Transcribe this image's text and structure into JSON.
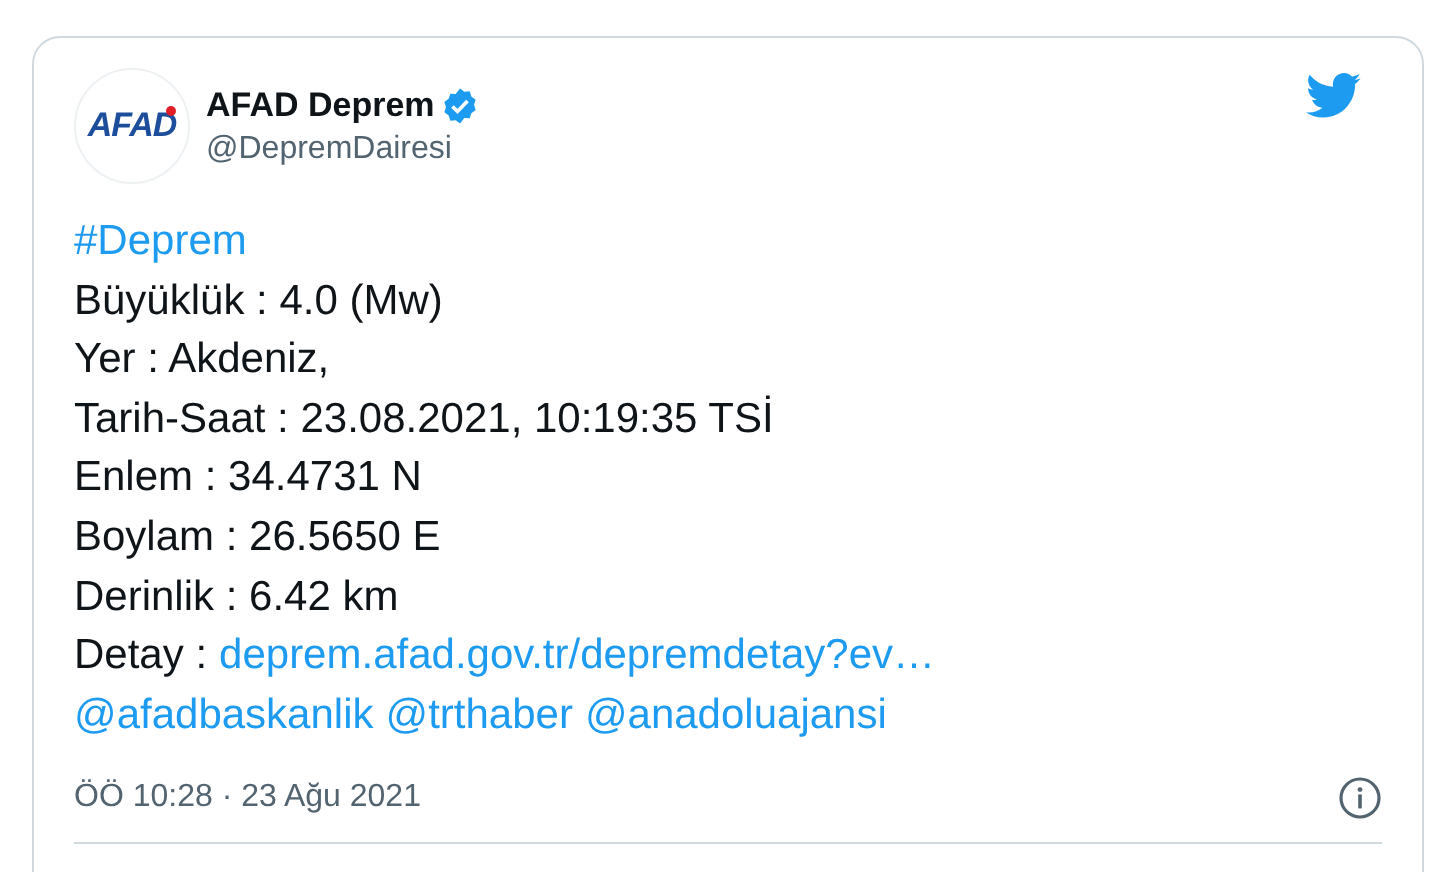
{
  "author": {
    "name": "AFAD Deprem",
    "verified": true,
    "handle": "@DepremDairesi",
    "avatar_text": "AFAD"
  },
  "lines": [
    [
      {
        "kind": "link",
        "text": "#Deprem"
      }
    ],
    [
      {
        "kind": "text",
        "text": "Büyüklük : 4.0 (Mw)"
      }
    ],
    [
      {
        "kind": "text",
        "text": "Yer : Akdeniz,"
      }
    ],
    [
      {
        "kind": "text",
        "text": "Tarih-Saat : 23.08.2021, 10:19:35 TSİ"
      }
    ],
    [
      {
        "kind": "text",
        "text": "Enlem : 34.4731 N"
      }
    ],
    [
      {
        "kind": "text",
        "text": "Boylam : 26.5650 E"
      }
    ],
    [
      {
        "kind": "text",
        "text": "Derinlik : 6.42 km"
      }
    ],
    [
      {
        "kind": "text",
        "text": "Detay :"
      },
      {
        "kind": "link",
        "text": "deprem.afad.gov.tr/depremdetay?ev…"
      }
    ],
    [
      {
        "kind": "link",
        "text": "@afadbaskanlik"
      },
      {
        "kind": "link",
        "text": "@trthaber"
      },
      {
        "kind": "link",
        "text": "@anadoluajansi"
      }
    ]
  ],
  "timestamp": "ÖÖ 10:28 · 23 Ağu 2021"
}
